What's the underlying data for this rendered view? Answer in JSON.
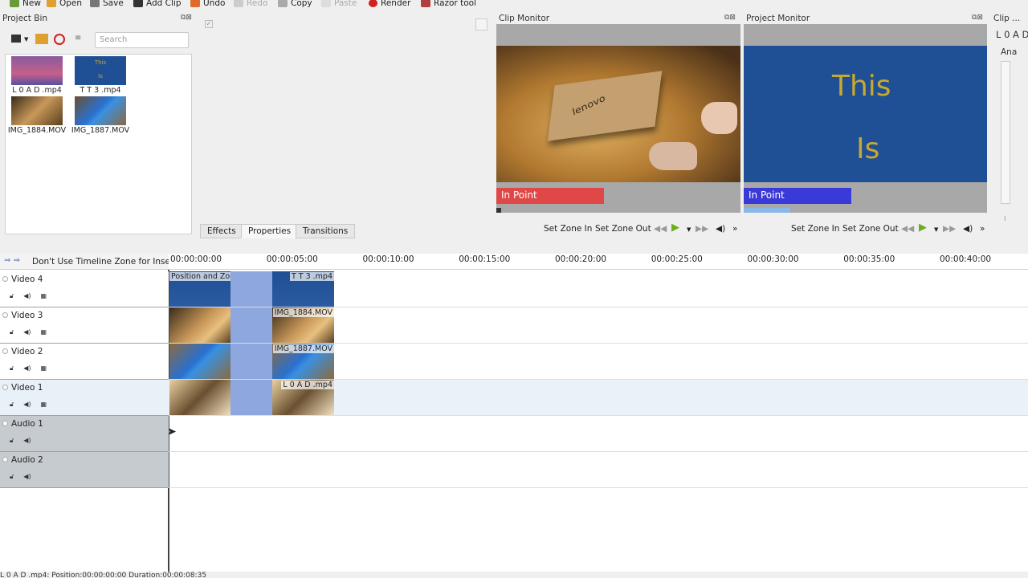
{
  "toolbar": {
    "new": "New",
    "open": "Open",
    "save": "Save",
    "add_clip": "Add Clip",
    "undo": "Undo",
    "redo": "Redo",
    "copy": "Copy",
    "paste": "Paste",
    "render": "Render",
    "razor": "Razor tool"
  },
  "project_bin": {
    "title": "Project Bin",
    "search_placeholder": "Search",
    "clips": [
      {
        "name": "L 0 A D .mp4"
      },
      {
        "name": "T T 3 .mp4",
        "thumb_text_1": "This",
        "thumb_text_2": "Is"
      },
      {
        "name": "IMG_1884.MOV"
      },
      {
        "name": "IMG_1887.MOV"
      }
    ]
  },
  "tabs": {
    "effects": "Effects",
    "properties": "Properties",
    "transitions": "Transitions"
  },
  "clip_monitor": {
    "title": "Clip Monitor",
    "in_point": "In Point",
    "set_zone_in": "Set Zone In",
    "set_zone_out": "Set Zone Out",
    "image_text": "lenovo"
  },
  "project_monitor": {
    "title": "Project Monitor",
    "in_point": "In Point",
    "set_zone_in": "Set Zone In",
    "set_zone_out": "Set Zone Out",
    "text_1": "This",
    "text_2": "Is"
  },
  "clip_properties": {
    "title": "Clip ...",
    "clip_name": "L 0 A D",
    "tab": "Ana"
  },
  "timeline": {
    "zone_option": "Don't Use Timeline Zone for Insert",
    "ruler": [
      "00:00:00:00",
      "00:00:05:00",
      "00:00:10:00",
      "00:00:15:00",
      "00:00:20:00",
      "00:00:25:00",
      "00:00:30:00",
      "00:00:35:00",
      "00:00:40:00"
    ],
    "tracks": [
      {
        "name": "Video 4",
        "clip_a": "Position and Zoom",
        "clip_b": "T T 3 .mp4"
      },
      {
        "name": "Video 3",
        "clip_b": "IMG_1884.MOV"
      },
      {
        "name": "Video 2",
        "clip_b": "IMG_1887.MOV"
      },
      {
        "name": "Video 1",
        "clip_b": "L 0 A D .mp4"
      },
      {
        "name": "Audio 1"
      },
      {
        "name": "Audio 2"
      }
    ]
  },
  "status": "L 0 A D .mp4: Position:00:00:00:00 Duration:00:00:08:35",
  "colors": {
    "in_point_red": "#e04848",
    "in_point_blue": "#3a3ad8",
    "title_blue": "#1f4f94",
    "transition": "#8ea8df"
  }
}
